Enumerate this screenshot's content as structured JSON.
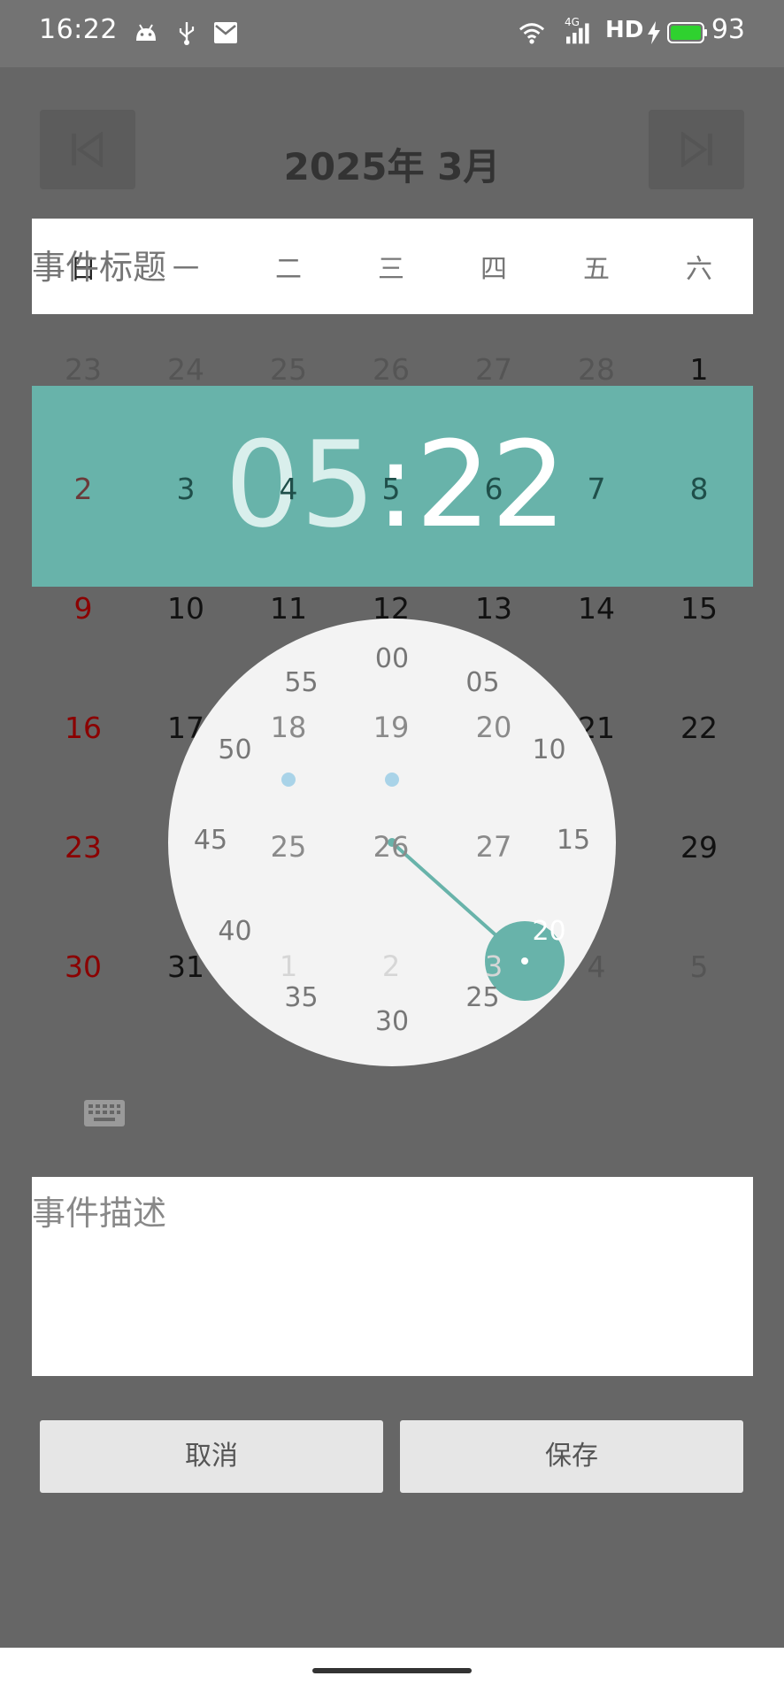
{
  "status_bar": {
    "time": "16:22",
    "signal_label": "4G",
    "hd_label": "HD",
    "battery": "93"
  },
  "header": {
    "month_title": "2025年 3月"
  },
  "event_title": {
    "placeholder": "事件标题"
  },
  "weekdays": [
    "日",
    "一",
    "二",
    "三",
    "四",
    "五",
    "六"
  ],
  "calendar": {
    "rows": [
      [
        "23",
        "24",
        "25",
        "26",
        "27",
        "28",
        "1"
      ],
      [
        "2",
        "3",
        "4",
        "5",
        "6",
        "7",
        "8"
      ],
      [
        "9",
        "10",
        "11",
        "12",
        "13",
        "14",
        "15"
      ],
      [
        "16",
        "17",
        "18",
        "19",
        "20",
        "21",
        "22"
      ],
      [
        "23",
        "24",
        "25",
        "26",
        "27",
        "28",
        "29"
      ],
      [
        "30",
        "31",
        "1",
        "2",
        "3",
        "4",
        "5"
      ]
    ]
  },
  "time_picker": {
    "hour": "05",
    "separator": ":",
    "minute": "22",
    "outer_labels": [
      "00",
      "05",
      "10",
      "15",
      "20",
      "25",
      "30",
      "35",
      "40",
      "45",
      "50",
      "55"
    ]
  },
  "event_description": {
    "placeholder": "事件描述"
  },
  "buttons": {
    "cancel": "取消",
    "save": "保存"
  },
  "colors": {
    "accent": "#68b3aa",
    "overlay": "#666666",
    "sunday": "#8b0000"
  }
}
